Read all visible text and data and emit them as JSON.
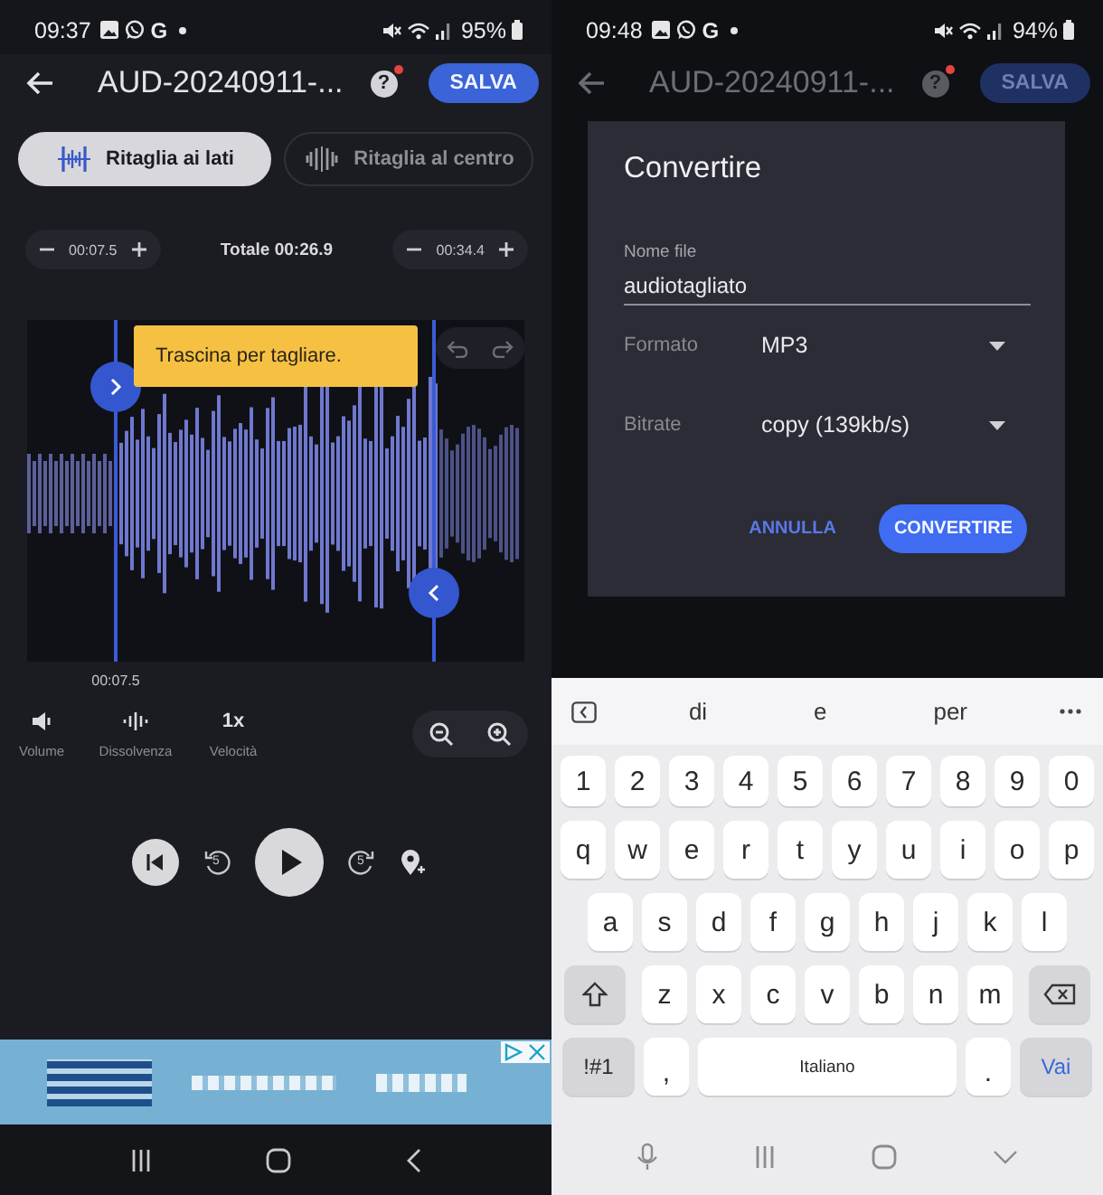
{
  "left": {
    "status_bar": {
      "time": "09:37",
      "letter": "G",
      "battery": "95%"
    },
    "header": {
      "title": "AUD-20240911-...",
      "help": "?",
      "has_notification": true,
      "save": "SALVA",
      "dimmed": false
    },
    "modes": [
      {
        "label": "Ritaglia ai lati",
        "selected": true
      },
      {
        "label": "Ritaglia al centro",
        "selected": false
      }
    ],
    "trim": {
      "start": "00:07.5",
      "total": "Totale 00:26.9",
      "end": "00:34.4"
    },
    "tooltip": "Trascina per tagliare.",
    "start_marker": "00:07.5",
    "tools": [
      {
        "kind": "volume",
        "label": "Volume"
      },
      {
        "kind": "fade",
        "label": "Dissolvenza"
      },
      {
        "kind": "text",
        "value": "1x",
        "label": "Velocità"
      }
    ],
    "player": {
      "rewind": "5",
      "forward": "5"
    }
  },
  "right": {
    "status_bar": {
      "time": "09:48",
      "letter": "G",
      "battery": "94%"
    },
    "header": {
      "title": "AUD-20240911-...",
      "help": "?",
      "has_notification": true,
      "save": "SALVA",
      "dimmed": true
    },
    "dialog": {
      "title": "Convertire",
      "fields": [
        {
          "kind": "text",
          "label": "Nome file",
          "value": "audiotagliato"
        },
        {
          "kind": "select",
          "label": "Formato",
          "value": "MP3"
        },
        {
          "kind": "select",
          "label": "Bitrate",
          "value": "copy (139kb/s)"
        }
      ],
      "buttons": [
        {
          "kind": "text",
          "label": "ANNULLA"
        },
        {
          "kind": "filled",
          "label": "CONVERTIRE"
        }
      ]
    },
    "keyboard": {
      "suggestions": [
        "di",
        "e",
        "per"
      ],
      "rows": [
        [
          {
            "kind": "char",
            "label": "1"
          },
          {
            "kind": "char",
            "label": "2"
          },
          {
            "kind": "char",
            "label": "3"
          },
          {
            "kind": "char",
            "label": "4"
          },
          {
            "kind": "char",
            "label": "5"
          },
          {
            "kind": "char",
            "label": "6"
          },
          {
            "kind": "char",
            "label": "7"
          },
          {
            "kind": "char",
            "label": "8"
          },
          {
            "kind": "char",
            "label": "9"
          },
          {
            "kind": "char",
            "label": "0"
          }
        ],
        [
          {
            "kind": "char",
            "label": "q"
          },
          {
            "kind": "char",
            "label": "w"
          },
          {
            "kind": "char",
            "label": "e"
          },
          {
            "kind": "char",
            "label": "r"
          },
          {
            "kind": "char",
            "label": "t"
          },
          {
            "kind": "char",
            "label": "y"
          },
          {
            "kind": "char",
            "label": "u"
          },
          {
            "kind": "char",
            "label": "i"
          },
          {
            "kind": "char",
            "label": "o"
          },
          {
            "kind": "char",
            "label": "p"
          }
        ],
        [
          {
            "kind": "char",
            "label": "a"
          },
          {
            "kind": "char",
            "label": "s"
          },
          {
            "kind": "char",
            "label": "d"
          },
          {
            "kind": "char",
            "label": "f"
          },
          {
            "kind": "char",
            "label": "g"
          },
          {
            "kind": "char",
            "label": "h"
          },
          {
            "kind": "char",
            "label": "j"
          },
          {
            "kind": "char",
            "label": "k"
          },
          {
            "kind": "char",
            "label": "l"
          }
        ],
        [
          {
            "kind": "shift"
          },
          {
            "kind": "char",
            "label": "z"
          },
          {
            "kind": "char",
            "label": "x"
          },
          {
            "kind": "char",
            "label": "c"
          },
          {
            "kind": "char",
            "label": "v"
          },
          {
            "kind": "char",
            "label": "b"
          },
          {
            "kind": "char",
            "label": "n"
          },
          {
            "kind": "char",
            "label": "m"
          },
          {
            "kind": "backspace"
          }
        ],
        [
          {
            "kind": "mod",
            "label": "!#1"
          },
          {
            "kind": "punct",
            "label": ","
          },
          {
            "kind": "space",
            "label": "Italiano"
          },
          {
            "kind": "punct",
            "label": "."
          },
          {
            "kind": "action",
            "label": "Vai"
          }
        ]
      ]
    }
  }
}
